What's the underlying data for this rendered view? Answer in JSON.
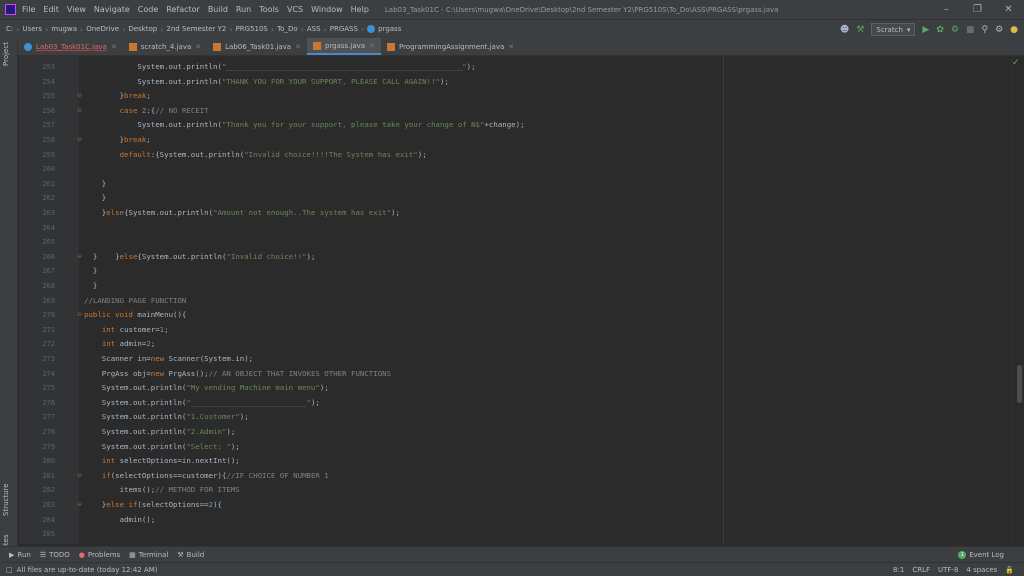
{
  "menubar": {
    "items": [
      "File",
      "Edit",
      "View",
      "Navigate",
      "Code",
      "Refactor",
      "Build",
      "Run",
      "Tools",
      "VCS",
      "Window",
      "Help"
    ],
    "window_title": "Lab03_Task01C - C:\\Users\\mugwa\\OneDrive\\Desktop\\2nd Semester Y2\\PRG510S\\To_Do\\ASS\\PRGASS\\prgass.java"
  },
  "navbar": {
    "breadcrumbs": [
      "C:",
      "Users",
      "mugwa",
      "OneDrive",
      "Desktop",
      "2nd Semester Y2",
      "PRG510S",
      "To_Do",
      "ASS",
      "PRGASS",
      "prgass"
    ],
    "run_config": "Scratch"
  },
  "tabs": [
    {
      "label": "Lab03_Task01C.java"
    },
    {
      "label": "scratch_4.java"
    },
    {
      "label": "Lab06_Task01.java"
    },
    {
      "label": "prgass.java"
    },
    {
      "label": "ProgrammingAssignment.java"
    }
  ],
  "side_labels": {
    "project": "Project",
    "structure": "Structure",
    "favorites": "Favorites"
  },
  "editor": {
    "lines": [
      {
        "n": "253",
        "code": "            System.out.println(\"_____________________________________________________\");"
      },
      {
        "n": "254",
        "code": "            System.out.println(\"THANK YOU FOR YOUR SUPPORT, PLEASE CALL AGAIN!!\");"
      },
      {
        "n": "255",
        "code": "        }break;"
      },
      {
        "n": "256",
        "code": "        case 2:{// NO RECEIT"
      },
      {
        "n": "257",
        "code": "            System.out.println(\"Thank you for your support, please take your change of N$\"+change);"
      },
      {
        "n": "258",
        "code": "        }break;"
      },
      {
        "n": "259",
        "code": "        default:{System.out.println(\"Invalid choice!!!!The System has exit\");"
      },
      {
        "n": "260",
        "code": ""
      },
      {
        "n": "261",
        "code": "    }"
      },
      {
        "n": "262",
        "code": "    }"
      },
      {
        "n": "263",
        "code": "    }else{System.out.println(\"Amount not enough..The system has exit\");"
      },
      {
        "n": "264",
        "code": ""
      },
      {
        "n": "265",
        "code": ""
      },
      {
        "n": "266",
        "code": "  }    }else{System.out.println(\"Invalid choice!!\");"
      },
      {
        "n": "267",
        "code": "  }"
      },
      {
        "n": "268",
        "code": "  }"
      },
      {
        "n": "269",
        "code": "//LANDING PAGE FUNCTION"
      },
      {
        "n": "270",
        "code": "public void mainMenu(){"
      },
      {
        "n": "271",
        "code": "    int customer=1;"
      },
      {
        "n": "272",
        "code": "    int admin=2;"
      },
      {
        "n": "273",
        "code": "    Scanner in=new Scanner(System.in);"
      },
      {
        "n": "274",
        "code": "    PrgAss obj=new PrgAss();// AN OBJECT THAT INVOKES OTHER FUNCTIONS"
      },
      {
        "n": "275",
        "code": "    System.out.println(\"My vending Machine main menu\");"
      },
      {
        "n": "276",
        "code": "    System.out.println(\"__________________________\");"
      },
      {
        "n": "277",
        "code": "    System.out.println(\"1.Customer\");"
      },
      {
        "n": "278",
        "code": "    System.out.println(\"2.Admin\");"
      },
      {
        "n": "279",
        "code": "    System.out.println(\"Select: \");"
      },
      {
        "n": "280",
        "code": "    int selectOptions=in.nextInt();"
      },
      {
        "n": "281",
        "code": "    if(selectOptions==customer){//IF CHOICE OF NUMBER 1"
      },
      {
        "n": "282",
        "code": "        items();// METHOD FOR ITEMS"
      },
      {
        "n": "283",
        "code": "    }else if(selectOptions==2){"
      },
      {
        "n": "284",
        "code": "        admin();"
      },
      {
        "n": "285",
        "code": ""
      }
    ]
  },
  "toolwindows": {
    "run": "Run",
    "todo": "TODO",
    "problems": "Problems",
    "terminal": "Terminal",
    "build": "Build",
    "event_log": "Event Log"
  },
  "status": {
    "message": "All files are up-to-date (today 12:42 AM)",
    "position": "8:1",
    "line_ending": "CRLF",
    "encoding": "UTF-8",
    "indent": "4 spaces"
  },
  "colors": {
    "keyword": "#cc7832",
    "string": "#6a8759",
    "number": "#6897bb",
    "comment": "#808080",
    "default": "#a9b7c6"
  }
}
